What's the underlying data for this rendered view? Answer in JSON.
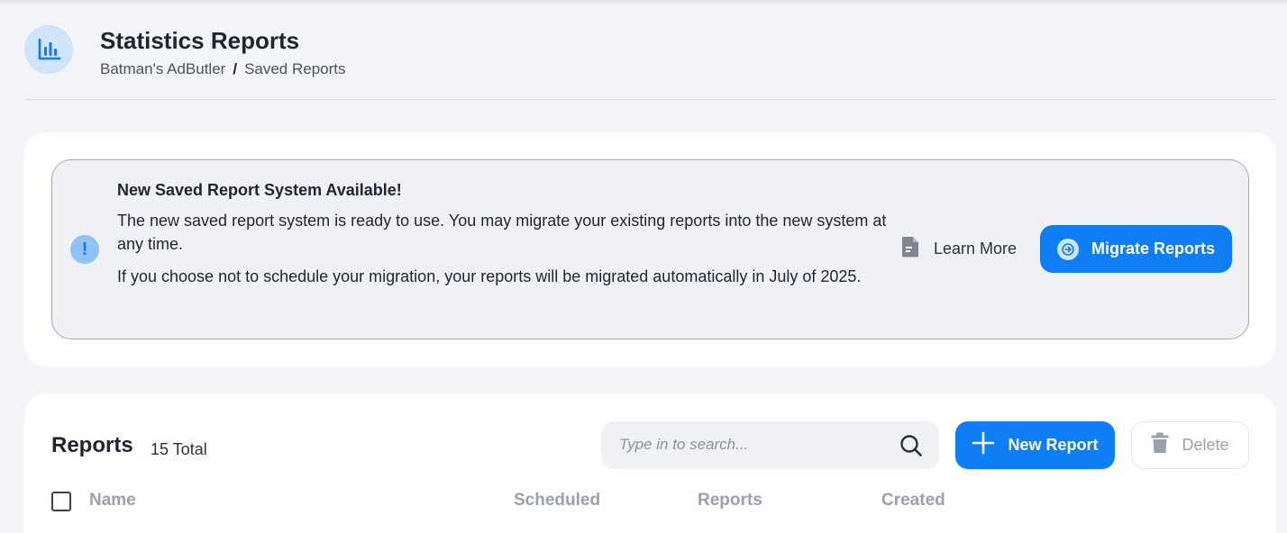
{
  "header": {
    "title": "Statistics Reports",
    "breadcrumb": [
      "Batman's AdButler",
      "Saved Reports"
    ],
    "breadcrumb_separator": "/"
  },
  "notice": {
    "title": "New Saved Report System Available!",
    "paragraph1": "The new saved report system is ready to use. You may migrate your existing reports into the new system at any time.",
    "paragraph2": "If you choose not to schedule your migration, your reports will be migrated automatically in July of 2025.",
    "learn_more_label": "Learn More",
    "migrate_label": "Migrate Reports",
    "icon_glyph": "!"
  },
  "reports": {
    "title": "Reports",
    "total": "15 Total",
    "search_placeholder": "Type in to search...",
    "new_report_label": "New Report",
    "delete_label": "Delete",
    "columns": [
      "Name",
      "Scheduled",
      "Reports",
      "Created"
    ]
  },
  "colors": {
    "accent": "#0f7ef5",
    "background": "#f3f4f7",
    "notice_bg": "#eff1f5"
  },
  "icons": {
    "header": "bar-chart-icon",
    "notice": "exclamation-icon",
    "learn_more": "document-icon",
    "migrate": "arrow-circle-icon",
    "search": "search-icon",
    "new_report": "plus-icon",
    "delete": "trash-icon"
  }
}
